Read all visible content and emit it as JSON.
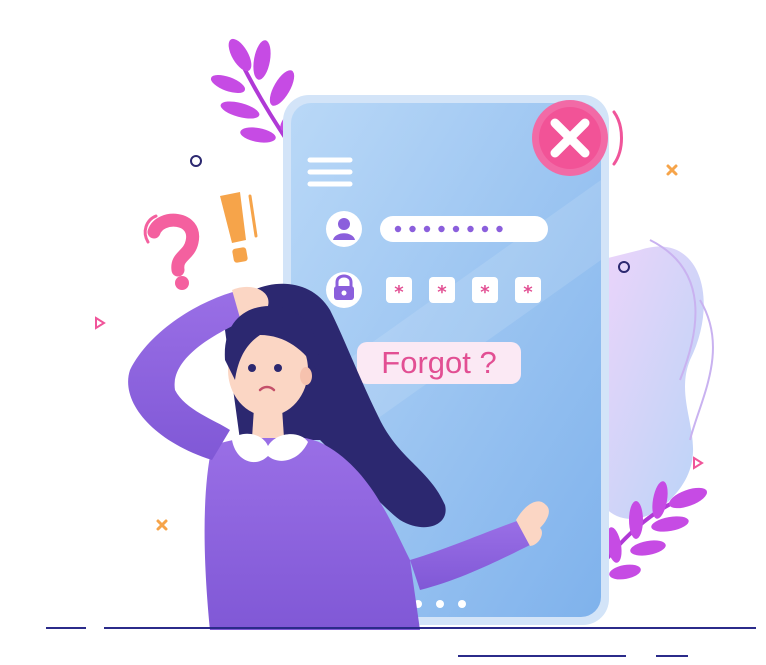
{
  "illustration": {
    "forgot_label": "Forgot ?",
    "pin_mask_char": "*",
    "password_dot_count": 8,
    "pin_box_count": 4,
    "pager_dot_count": 3,
    "icons": {
      "menu": "hamburger-menu-icon",
      "user": "user-avatar-icon",
      "lock": "padlock-icon",
      "error": "close-x-icon",
      "question": "question-mark-icon",
      "exclamation": "exclamation-mark-icon"
    },
    "colors": {
      "phone_screen": "#9cc6f2",
      "phone_frame": "#cfe2f7",
      "accent_pink": "#f0559a",
      "accent_orange": "#f6a44a",
      "sweater_purple": "#8f63df",
      "hair_navy": "#2c2870",
      "leaf_magenta": "#c64be4",
      "ground_line": "#2b2b8a"
    }
  }
}
